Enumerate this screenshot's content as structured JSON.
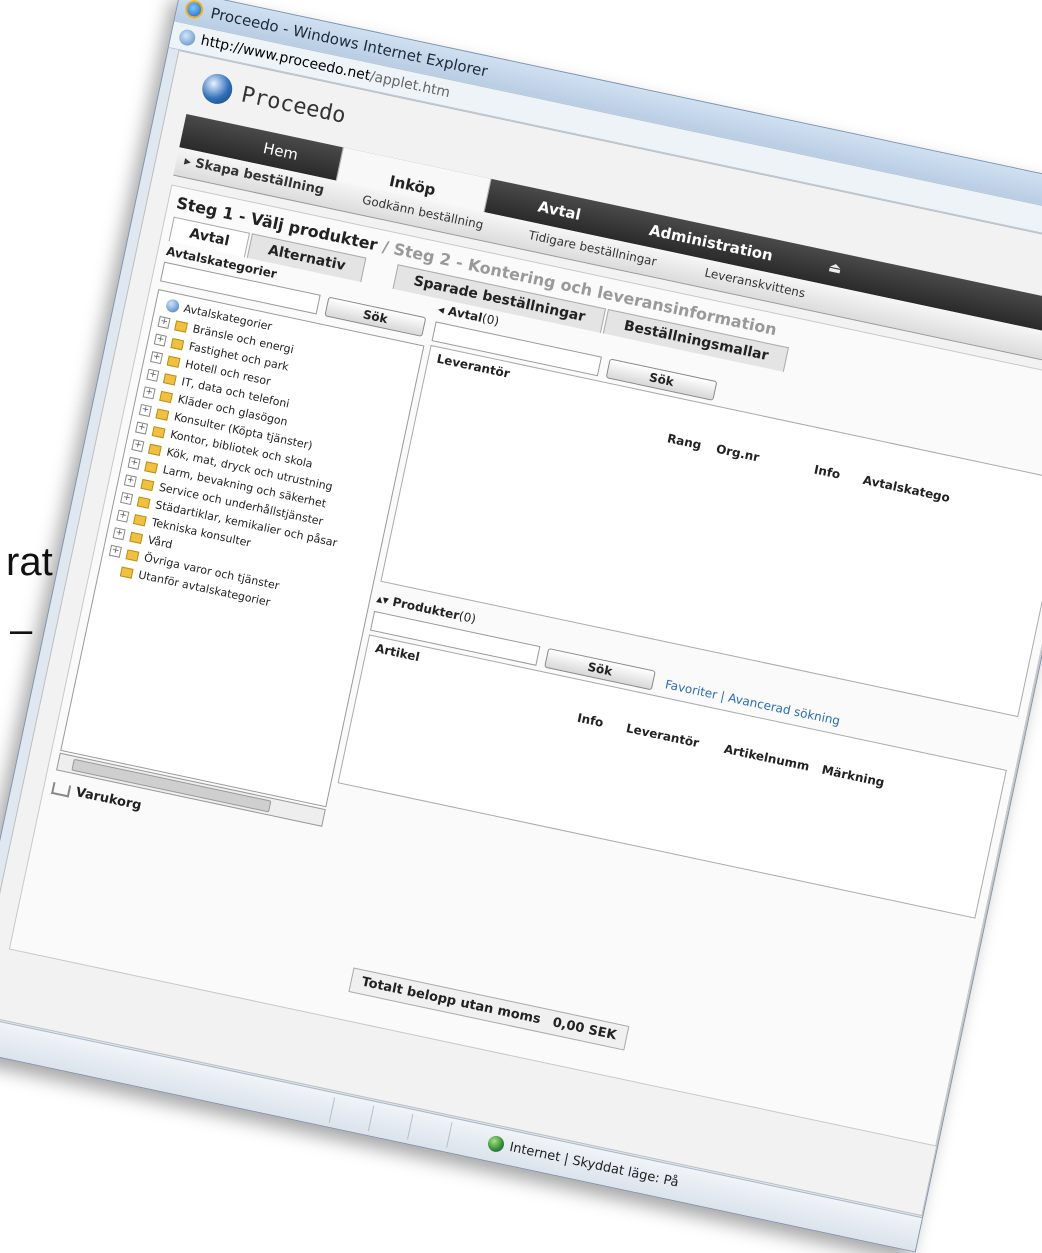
{
  "background": {
    "fragment1": "rat",
    "fragment2": "–"
  },
  "window": {
    "title": "Proceedo - Windows Internet Explorer",
    "address_host": "http://www.proceedo.net",
    "address_path": "/applet.htm"
  },
  "app": {
    "brand": "Proceedo",
    "nav": {
      "hem": "Hem",
      "inkop": "Inköp",
      "avtal": "Avtal",
      "administration": "Administration"
    },
    "subnav": {
      "skapa": "Skapa beställning",
      "godkann": "Godkänn beställning",
      "tidigare": "Tidigare beställningar",
      "leverans": "Leveranskvittens"
    },
    "steps": {
      "step1": "Steg 1 - Välj produkter",
      "separator": "/",
      "step2": "Steg 2 - Kontering och leveransinformation"
    },
    "tabs": {
      "avtal": "Avtal",
      "alternativ": "Alternativ",
      "sparade": "Sparade beställningar",
      "mallar": "Beställningsmallar"
    },
    "left": {
      "label": "Avtalskategorier",
      "search_button": "Sök",
      "tree_root": "Avtalskategorier",
      "tree_items": [
        "Bränsle och energi",
        "Fastighet och park",
        "Hotell och resor",
        "IT, data och telefoni",
        "Kläder och glasögon",
        "Konsulter (Köpta tjänster)",
        "Kontor, bibliotek och skola",
        "Kök, mat, dryck och utrustning",
        "Larm, bevakning och säkerhet",
        "Service och underhållstjänster",
        "Städartiklar, kemikalier och påsar",
        "Tekniska konsulter",
        "Vård",
        "Övriga varor och tjänster",
        "Utanför avtalskategorier"
      ],
      "cart": "Varukorg"
    },
    "avtal_panel": {
      "label": "Avtal",
      "count": "(0)",
      "search_button": "Sök",
      "columns": [
        "Leverantör",
        "Rang",
        "Org.nr",
        "Info",
        "Avtalskatego"
      ]
    },
    "produkter_panel": {
      "label": "Produkter",
      "count": "(0)",
      "search_button": "Sök",
      "col_artikel": "Artikel",
      "favoriter": "Favoriter",
      "avancerad": "Avancerad sökning",
      "columns": [
        "Info",
        "Leverantör",
        "Artikelnumm",
        "Märkning"
      ]
    },
    "total": {
      "label": "Totalt belopp utan moms",
      "value": "0,00 SEK"
    }
  },
  "statusbar": {
    "zone": "Internet | Skyddat läge: På"
  }
}
